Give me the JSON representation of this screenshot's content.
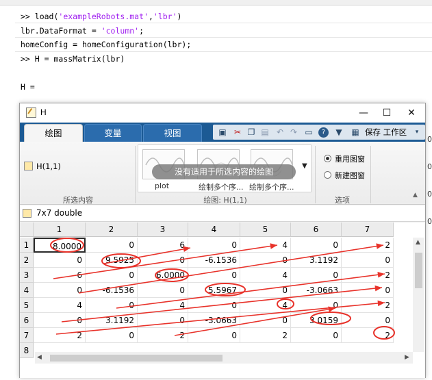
{
  "command_window": {
    "lines": [
      {
        "prompt": ">> ",
        "code": "load(",
        "str1": "'exampleRobots.mat'",
        "mid": ",",
        "str2": "'lbr'",
        "end": ")"
      },
      {
        "code": "lbr.DataFormat = ",
        "str1": "'column'",
        "end": ";"
      },
      {
        "code": "homeConfig = homeConfiguration(lbr);"
      },
      {
        "prompt": ">> ",
        "code": "H = massMatrix(lbr)"
      },
      {
        "code": ""
      },
      {
        "code": "H ="
      }
    ],
    "right_digits": [
      "0",
      "0",
      "0",
      "0"
    ]
  },
  "window": {
    "title": "H",
    "minimize": "—",
    "maximize": "☐",
    "close": "✕"
  },
  "ribbon": {
    "tabs": [
      {
        "label": "绘图",
        "active": true
      },
      {
        "label": "变量",
        "active": false
      },
      {
        "label": "视图",
        "active": false
      }
    ],
    "layout_button": "保存 工作区",
    "selection_text": "H(1,1)",
    "section_selection": "所选内容",
    "gallery_message": "没有适用于所选内容的绘图",
    "gallery_items": [
      "plot",
      "绘制多个序...",
      "绘制多个序..."
    ],
    "section_plots": "绘图: H(1,1)",
    "option_reuse": "重用图窗",
    "option_new": "新建图窗",
    "section_options": "选项"
  },
  "variable": {
    "info": "7x7 double"
  },
  "table": {
    "col_headers": [
      "1",
      "2",
      "3",
      "4",
      "5",
      "6",
      "7"
    ],
    "row_headers": [
      "1",
      "2",
      "3",
      "4",
      "5",
      "6",
      "7",
      "8"
    ],
    "rows": [
      [
        "8.0000",
        "0",
        "6",
        "0",
        "4",
        "0",
        "2"
      ],
      [
        "0",
        "9.5925",
        "0",
        "-6.1536",
        "0",
        "3.1192",
        "0"
      ],
      [
        "6",
        "0",
        "6.0000",
        "0",
        "4",
        "0",
        "2"
      ],
      [
        "0",
        "-6.1536",
        "0",
        "5.5967",
        "0",
        "-3.0663",
        "0"
      ],
      [
        "4",
        "0",
        "4",
        "0",
        "4",
        "0",
        "2"
      ],
      [
        "0",
        "3.1192",
        "0",
        "-3.0663",
        "0",
        "3.0159",
        "0"
      ],
      [
        "2",
        "0",
        "2",
        "0",
        "2",
        "0",
        "2"
      ]
    ],
    "selected_cell": "H(1,1)"
  },
  "colors": {
    "tab_bar": "#1c5a94",
    "annotation": "#e8322a"
  },
  "icons": {
    "save": "save-icon",
    "cut": "cut-icon",
    "copy": "copy-icon",
    "paste": "paste-icon",
    "undo": "undo-icon",
    "redo": "redo-icon",
    "help": "help-icon",
    "layout": "layout-icon"
  }
}
